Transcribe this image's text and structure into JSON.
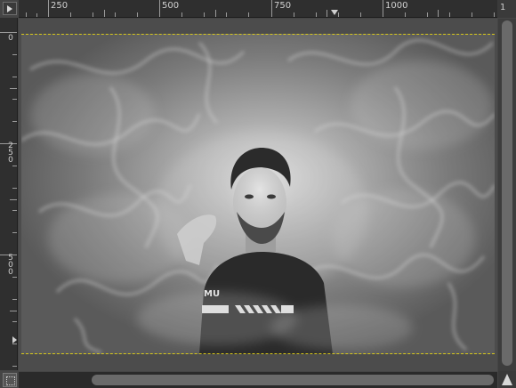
{
  "rulers": {
    "horizontal_labels": [
      "250",
      "500",
      "750",
      "1000"
    ],
    "end_label": "1",
    "vertical_labels": [
      "0",
      "250",
      "500"
    ]
  },
  "icons": {
    "corner": "menu-triangle-icon",
    "quickmask": "quick-mask-icon",
    "navigate": "navigate-icon"
  },
  "colors": {
    "canvas_bg": "#4c4c4c",
    "boundary": "#d8c81a",
    "ruler_bg": "#2f2f2f"
  },
  "image": {
    "shirt_text": "MU",
    "style": "grayscale-portrait-with-smoke"
  }
}
